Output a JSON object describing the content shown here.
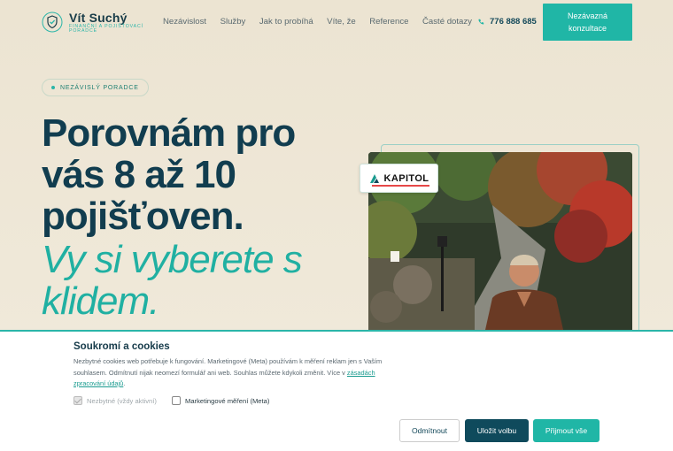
{
  "header": {
    "brand_name": "Vít Suchý",
    "brand_sub": "FINANČNÍ A POJIŠŤOVACÍ PORADCE",
    "nav": [
      "Nezávislost",
      "Služby",
      "Jak to probíhá",
      "Víte, že",
      "Reference",
      "Časté dotazy"
    ],
    "phone": "776 888 685",
    "cta_label": "Nezávazná konzultace"
  },
  "hero": {
    "badge": "NEZÁVISLÝ PORADCE",
    "headline": "Porovnám pro vás 8 až 10 pojišťoven.",
    "headline_accent": "Vy si vyberete s klidem.",
    "partner_logo": "KAPITOL"
  },
  "cookie": {
    "title": "Soukromí a cookies",
    "text": "Nezbytné cookies web potřebuje k fungování. Marketingové (Meta) používám k měření reklam jen s Vaším souhlasem. Odmítnutí nijak neomezí formulář ani web. Souhlas můžete kdykoli změnit. Více v",
    "link": "zásadách zpracování údajů",
    "link_suffix": ".",
    "opt_necessary": "Nezbytné (vždy aktivní)",
    "opt_marketing": "Marketingové měření (Meta)",
    "btn_refuse": "Odmítnout",
    "btn_save": "Uložit volbu",
    "btn_accept": "Přijmout vše"
  },
  "colors": {
    "accent": "#20b6a6",
    "dark": "#113d4f",
    "background": "#ece4d2"
  }
}
